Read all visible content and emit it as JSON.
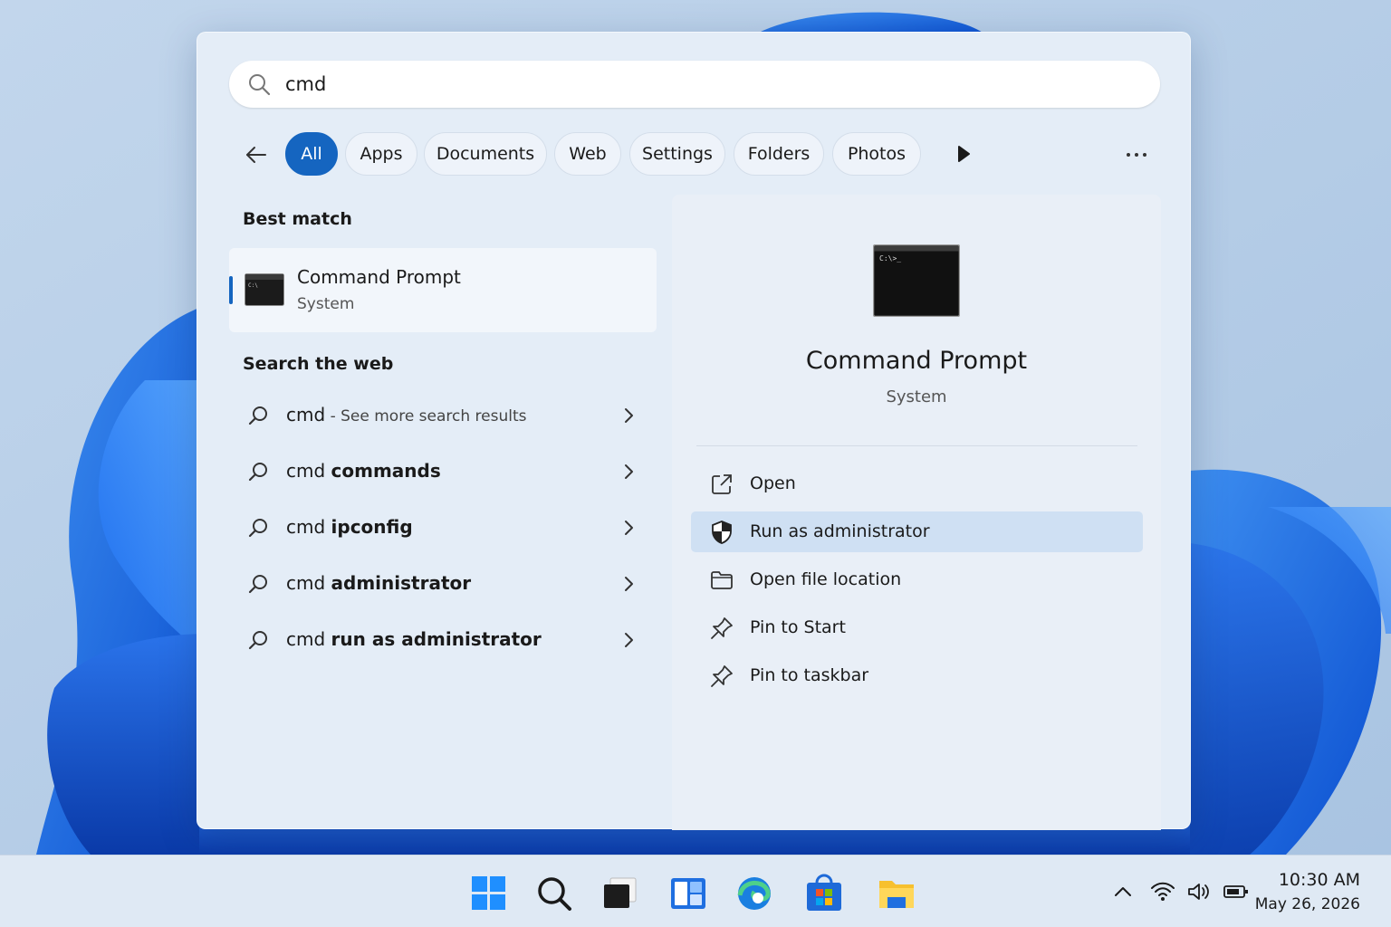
{
  "search": {
    "value": "cmd",
    "placeholder": ""
  },
  "filters": {
    "back_label": "",
    "chips": [
      {
        "label": "All",
        "active": true
      },
      {
        "label": "Apps"
      },
      {
        "label": "Documents"
      },
      {
        "label": "Web"
      },
      {
        "label": "Settings"
      },
      {
        "label": "Folders"
      },
      {
        "label": "Photos"
      }
    ]
  },
  "best_match": {
    "section_title": "Best match",
    "name": "Command Prompt",
    "type": "System"
  },
  "web": {
    "section_title": "Search the web",
    "items": [
      {
        "prefix": "cmd",
        "bold": "",
        "suffix": " - See more search results"
      },
      {
        "prefix": "cmd ",
        "bold": "commands",
        "suffix": ""
      },
      {
        "prefix": "cmd ",
        "bold": "ipconfig",
        "suffix": ""
      },
      {
        "prefix": "cmd ",
        "bold": "administrator",
        "suffix": ""
      },
      {
        "prefix": "cmd ",
        "bold": "run as administrator",
        "suffix": ""
      }
    ]
  },
  "preview": {
    "title": "Command Prompt",
    "subtitle": "System",
    "actions": [
      {
        "label": "Open",
        "icon": "open-external-icon"
      },
      {
        "label": "Run as administrator",
        "icon": "shield-icon",
        "highlighted": true
      },
      {
        "label": "Open file location",
        "icon": "folder-icon"
      },
      {
        "label": "Pin to Start",
        "icon": "pin-icon"
      },
      {
        "label": "Pin to taskbar",
        "icon": "pin-icon"
      }
    ]
  },
  "taskbar": {
    "time": "10:30 AM",
    "date": "May 26, 2026"
  },
  "colors": {
    "accent": "#1565c0",
    "highlight": "#cfe0f3"
  }
}
